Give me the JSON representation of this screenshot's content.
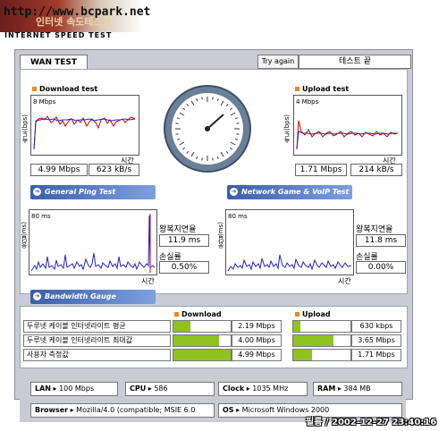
{
  "header": {
    "url": "http://www.bcpark.net",
    "logo_text": "인터넷 속도테스트",
    "subtitle": "INTERNET SPEED TEST"
  },
  "toolbar": {
    "tab_label": "WAN TEST",
    "try_again_label": "Try again",
    "status_text": "테스트 끝"
  },
  "download": {
    "title": "Download test",
    "ylabel": "속도(bps)",
    "scale": "8 Mbps",
    "xlabel": "시간",
    "value_mbps": "4.99 Mbps",
    "value_kbs": "623 kB/s"
  },
  "upload": {
    "title": "Upload test",
    "ylabel": "속도(bps)",
    "scale": "4 Mbps",
    "xlabel": "시간",
    "value_mbps": "1.71 Mbps",
    "value_kbs": "214 kB/s"
  },
  "ping": {
    "bar_label": "General Ping Test",
    "ylabel": "응답(ms)",
    "scale": "80 ms",
    "xlabel": "시간",
    "rtt_label": "왕복지연율",
    "rtt_value": "11.9 ms",
    "loss_label": "손실률",
    "loss_value": "0.50%"
  },
  "game": {
    "bar_label": "Network Game & VoIP Test",
    "ylabel": "응답(ms)",
    "scale": "80 ms",
    "xlabel": "시간",
    "rtt_label": "왕복지연율",
    "rtt_value": "11.8 ms",
    "loss_label": "손실률",
    "loss_value": "0.00%"
  },
  "gauge": {
    "bar_label": "Bandwidth Gauge",
    "download_header": "Download",
    "upload_header": "Upload",
    "accent_color": "#8fc31f",
    "rows": [
      {
        "label": "두루넷 케이블 인터넷라이트 평균",
        "dl_fraction": 0.29,
        "dl_value": "2.19 Mbps",
        "ul_fraction": 0.12,
        "ul_value": "630 kbps"
      },
      {
        "label": "두루넷 케이블 인터넷라이트 최대값",
        "dl_fraction": 0.8,
        "dl_value": "4.00 Mbps",
        "ul_fraction": 0.7,
        "ul_value": "3.65 Mbps"
      },
      {
        "label": "사용자 측정값",
        "dl_fraction": 1.0,
        "dl_value": "4.99 Mbps",
        "ul_fraction": 0.33,
        "ul_value": "1.71 Mbps"
      }
    ]
  },
  "system": {
    "lan_label": "LAN",
    "lan_value": "100 Mbps",
    "cpu_label": "CPU",
    "cpu_value": "586",
    "clock_label": "Clock",
    "clock_value": "1035 MHz",
    "ram_label": "RAM",
    "ram_value": "384 MB",
    "browser_label": "Browser",
    "browser_value": "Mozilla/4.0 (compatible; MSIE 6.0",
    "os_label": "OS",
    "os_value": "Microsoft Windows 2000"
  },
  "stamp": "필름 / 2002-12-27 23:40:16"
}
